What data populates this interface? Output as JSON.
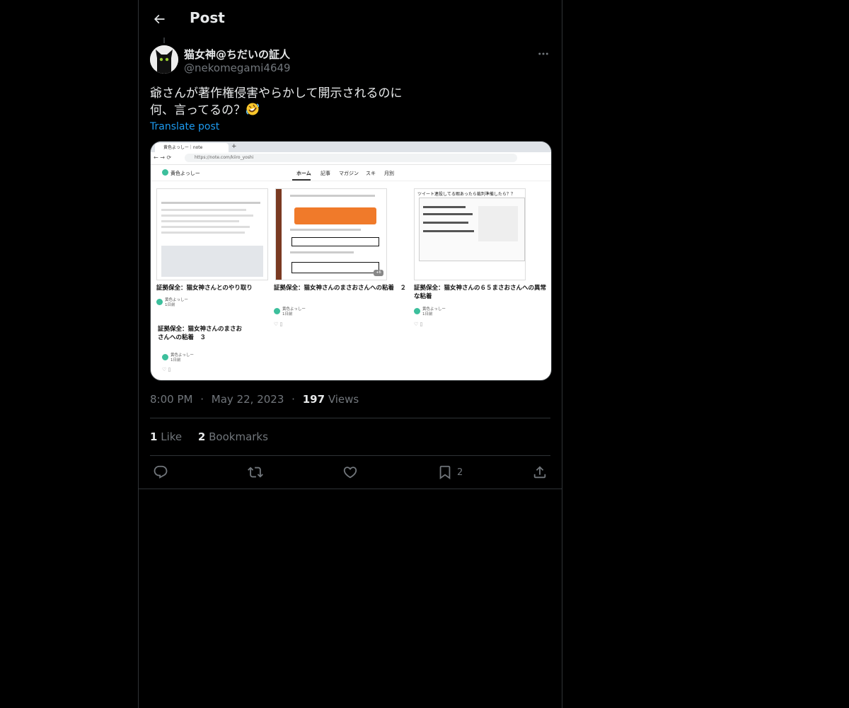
{
  "header": {
    "title": "Post"
  },
  "author": {
    "display_name": "猫女神@ちだいの証人",
    "handle": "@nekomegami4649"
  },
  "post": {
    "line1": "爺さんが著作権侵害やらかして開示されるのに",
    "line2": "何、言ってるの？",
    "emoji": "rolling-on-floor-laughing-emoji",
    "translate_label": "Translate post"
  },
  "media": {
    "tab_title": "黄色よっしー｜note",
    "url": "https://note.com/kiiro_yoshi",
    "site_name": "黄色よっしー",
    "nav": [
      "ホーム",
      "記事",
      "マガジン",
      "スキ",
      "月別"
    ],
    "cards": [
      {
        "title": "証拠保全：猫女神さんとのやり取り",
        "author": "黄色よっしー",
        "date": "1日前"
      },
      {
        "title": "証拠保全：猫女神さんのまさおさんへの粘着　２",
        "author": "黄色よっしー",
        "date": "1日前"
      },
      {
        "title": "証拠保全：猫女神さんの６５まさおさんへの異常な粘着",
        "author": "黄色よっしー",
        "date": "1日前"
      },
      {
        "title": "証拠保全：猫女神さんのまさおさんへの粘着　３",
        "author": "黄色よっしー",
        "date": "1日前"
      }
    ],
    "thumb3_caption": "ツイート連投してる暇あったら裁判準備したら？？",
    "plus_badge": "+6"
  },
  "meta": {
    "time": "8:00 PM",
    "date": "May 22, 2023",
    "views_count": "197",
    "views_label": "Views",
    "sep": "·"
  },
  "stats": {
    "likes_count": "1",
    "likes_label": "Like",
    "bookmarks_count": "2",
    "bookmarks_label": "Bookmarks"
  },
  "actions": {
    "bookmark_count": "2"
  },
  "colors": {
    "background": "#000000",
    "text": "#e7e9ea",
    "secondary": "#71767b",
    "accent": "#1d9bf0",
    "border": "#2f3336"
  }
}
